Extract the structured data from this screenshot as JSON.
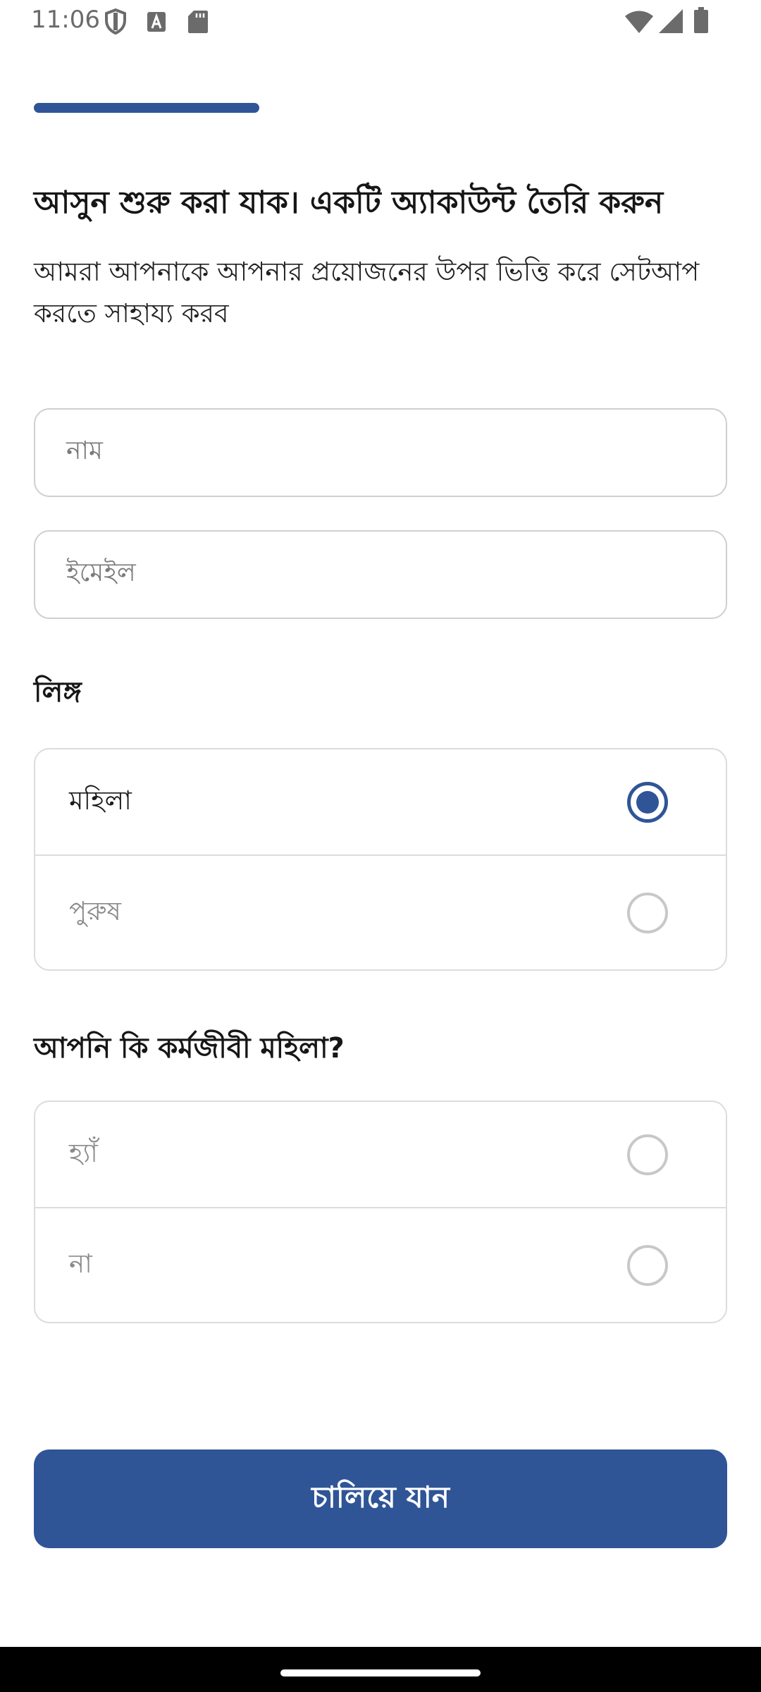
{
  "status_bar": {
    "time": "11:06"
  },
  "colors": {
    "accent": "#2f5597",
    "progress": "#2f5597"
  },
  "progress": {
    "fraction": 0.2
  },
  "header": {
    "title": "আসুন শুরু করা যাক। একটি অ্যাকাউন্ট তৈরি করুন",
    "subtitle": "আমরা আপনাকে আপনার প্রয়োজনের উপর ভিত্তি করে সেটআপ করতে সাহায্য করব"
  },
  "form": {
    "name_placeholder": "নাম",
    "email_placeholder": "ইমেইল",
    "gender": {
      "label": "লিঙ্গ",
      "options": [
        {
          "label": "মহিলা",
          "selected": true
        },
        {
          "label": "পুরুষ",
          "selected": false
        }
      ]
    },
    "working": {
      "label": "আপনি কি কর্মজীবী মহিলা?",
      "options": [
        {
          "label": "হ্যাঁ",
          "selected": false
        },
        {
          "label": "না",
          "selected": false
        }
      ]
    }
  },
  "continue_label": "চালিয়ে যান"
}
